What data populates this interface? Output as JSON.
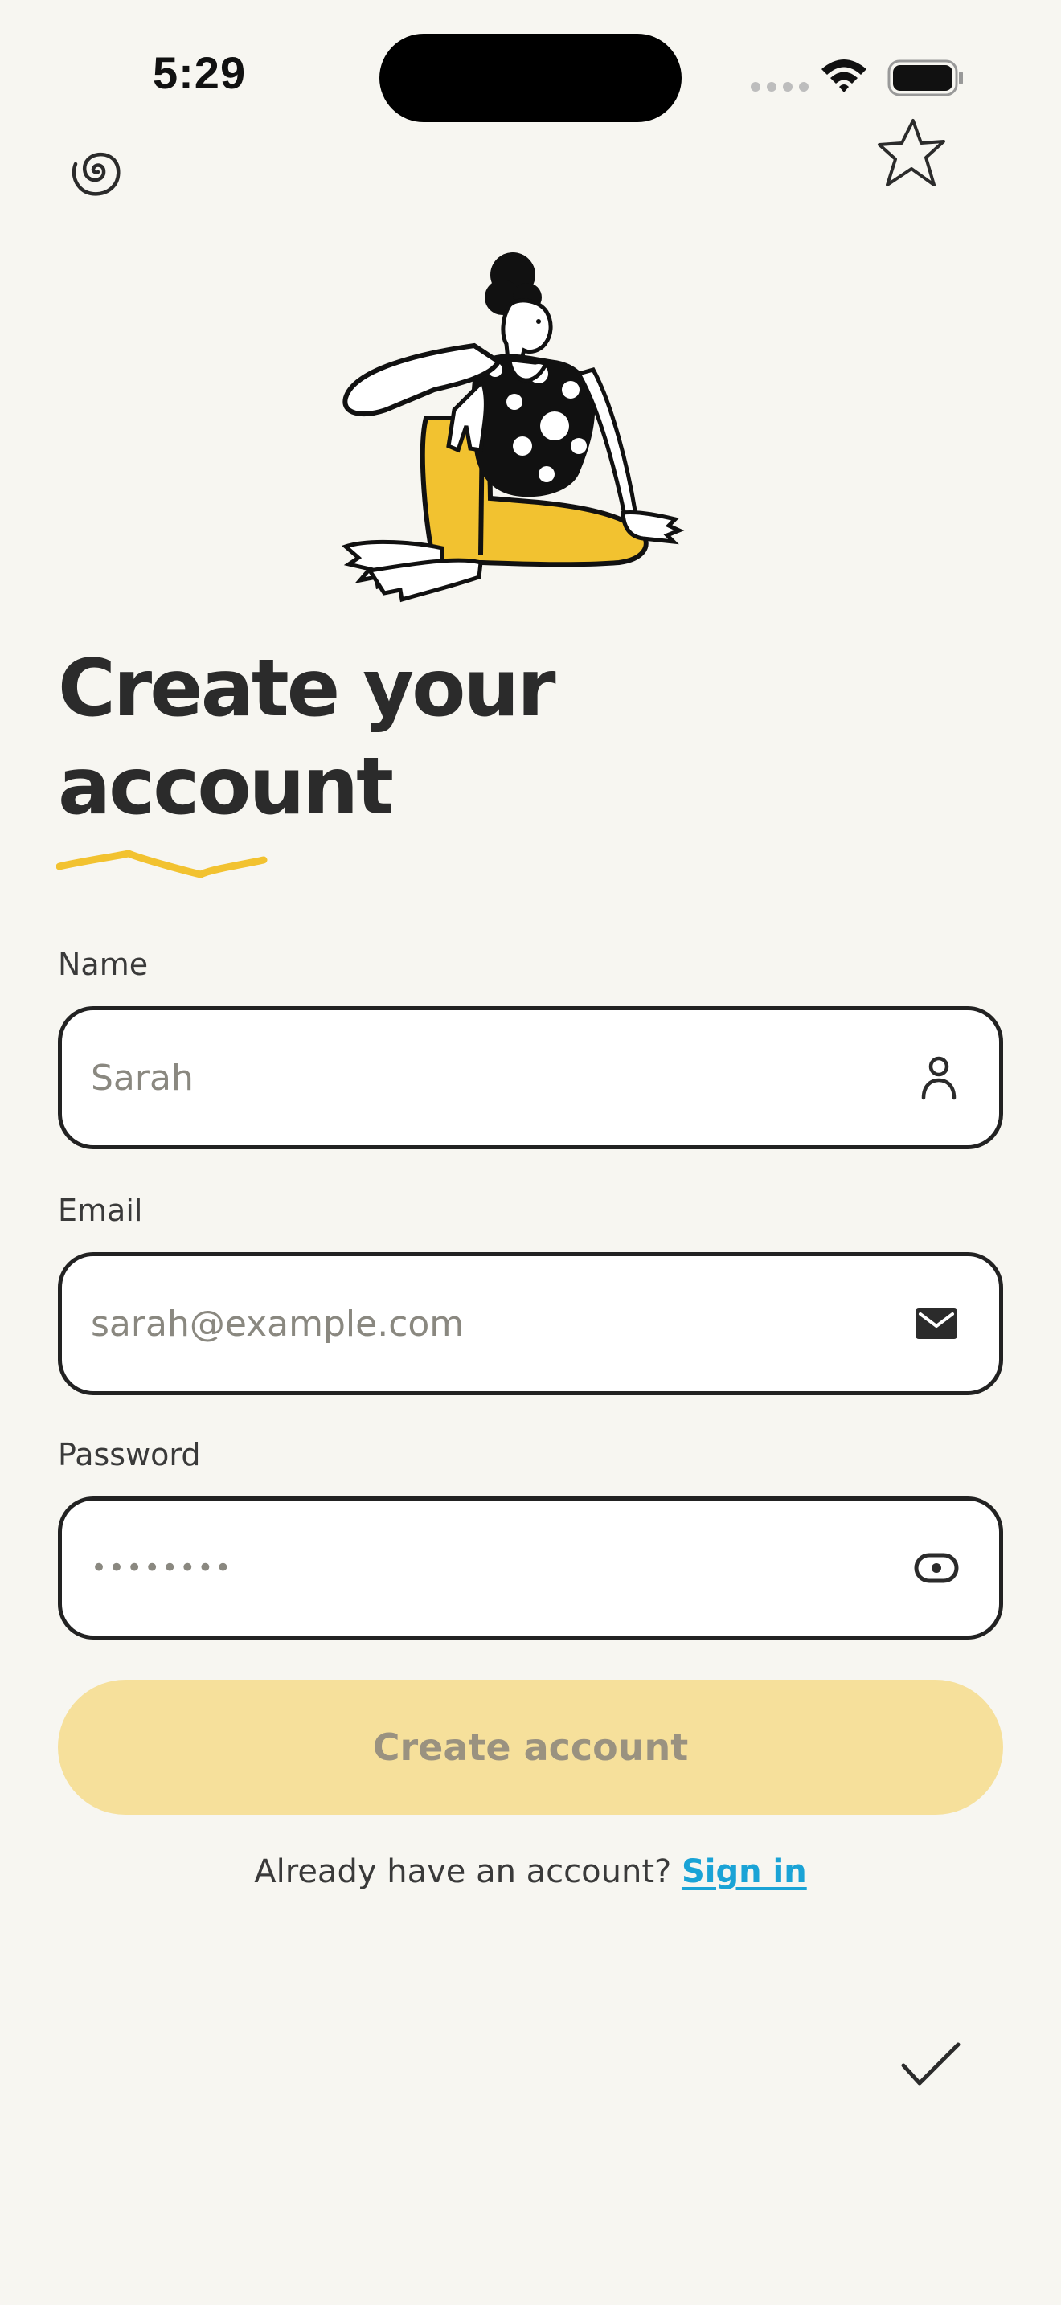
{
  "status_bar": {
    "time": "5:29"
  },
  "header": {
    "left_icon": "spiral-icon",
    "right_icon": "star-icon"
  },
  "title": {
    "line1": "Create your",
    "line2": "account"
  },
  "form": {
    "name": {
      "label": "Name",
      "placeholder": "Sarah",
      "icon": "person-icon"
    },
    "email": {
      "label": "Email",
      "placeholder": "sarah@example.com",
      "icon": "mail-icon"
    },
    "password": {
      "label": "Password",
      "value": "••••••••",
      "icon": "eye-icon"
    }
  },
  "primary_button": {
    "label": "Create account"
  },
  "footer": {
    "prompt": "Already have an account?",
    "link": "Sign in"
  },
  "bottom_icon": "checkmark-icon",
  "colors": {
    "background": "#f7f6f1",
    "accent_yellow": "#f2c230",
    "button_disabled": "#f6e09b",
    "link": "#1aa3d6"
  }
}
